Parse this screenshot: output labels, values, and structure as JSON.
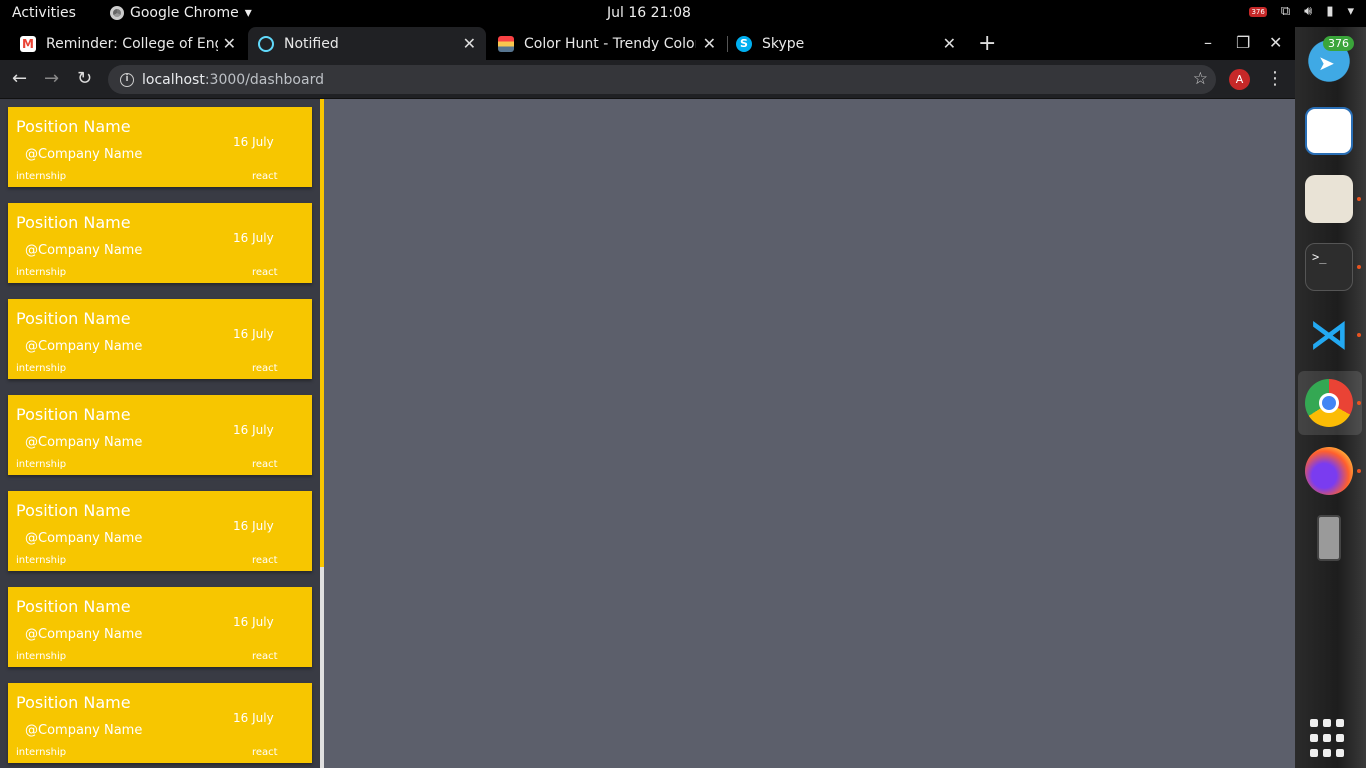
{
  "system_bar": {
    "activities": "Activities",
    "app_name": "Google Chrome",
    "clock": "Jul 16  21:08",
    "notif_badge": "376"
  },
  "tabs": [
    {
      "title": "Reminder: College of Eng",
      "icon": "gmail-icon",
      "color": "#ea4335"
    },
    {
      "title": "Notified",
      "icon": "react-icon",
      "color": "#61dafb"
    },
    {
      "title": "Color Hunt - Trendy Color",
      "icon": "colorhunt-icon",
      "color": "#f2c94c"
    },
    {
      "title": "Skype",
      "icon": "skype-icon",
      "color": "#00aff0"
    }
  ],
  "toolbar": {
    "url_host": "localhost",
    "url_path": ":3000/dashboard",
    "avatar_letter": "A"
  },
  "cards": [
    {
      "position": "Position Name",
      "company": "@Company Name",
      "date": "16 July",
      "type": "internship",
      "tag": "react"
    },
    {
      "position": "Position Name",
      "company": "@Company Name",
      "date": "16 July",
      "type": "internship",
      "tag": "react"
    },
    {
      "position": "Position Name",
      "company": "@Company Name",
      "date": "16 July",
      "type": "internship",
      "tag": "react"
    },
    {
      "position": "Position Name",
      "company": "@Company Name",
      "date": "16 July",
      "type": "internship",
      "tag": "react"
    },
    {
      "position": "Position Name",
      "company": "@Company Name",
      "date": "16 July",
      "type": "internship",
      "tag": "react"
    },
    {
      "position": "Position Name",
      "company": "@Company Name",
      "date": "16 July",
      "type": "internship",
      "tag": "react"
    },
    {
      "position": "Position Name",
      "company": "@Company Name",
      "date": "16 July",
      "type": "internship",
      "tag": "react"
    }
  ],
  "dock": {
    "telegram_count": "376",
    "apps": [
      "telegram-icon",
      "libreoffice-writer-icon",
      "files-icon",
      "terminal-icon",
      "vscode-icon",
      "chrome-icon",
      "firefox-icon",
      "phone-icon",
      "app-grid-icon"
    ]
  },
  "colors": {
    "card": "#f7c600",
    "sidebar": "#393b44",
    "main": "#5c5f6b"
  }
}
